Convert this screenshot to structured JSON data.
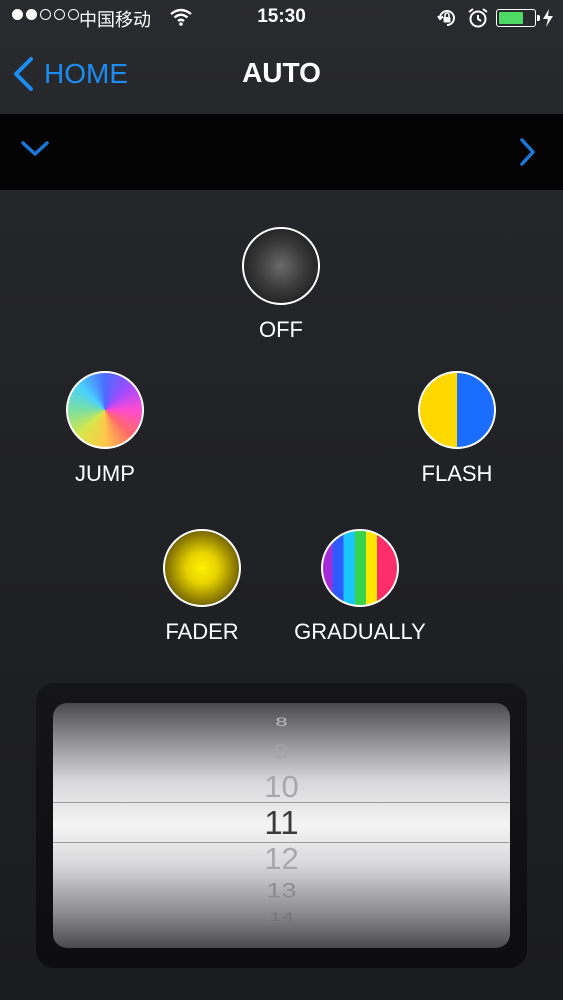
{
  "status_bar": {
    "carrier": "中国移动",
    "time": "15:30",
    "battery_level": 0.7,
    "icons": [
      "signal-dots",
      "wifi-icon",
      "rotation-lock-icon",
      "alarm-icon",
      "battery-icon",
      "charging-bolt-icon"
    ]
  },
  "nav": {
    "back_label": "HOME",
    "title": "AUTO",
    "accent_color": "#1b8df2"
  },
  "modes": {
    "off": "OFF",
    "jump": "JUMP",
    "flash": "FLASH",
    "fader": "FADER",
    "gradually": "GRADUALLY"
  },
  "picker": {
    "items": [
      "8",
      "9",
      "10",
      "11",
      "12",
      "13",
      "14"
    ],
    "selected": "11"
  }
}
